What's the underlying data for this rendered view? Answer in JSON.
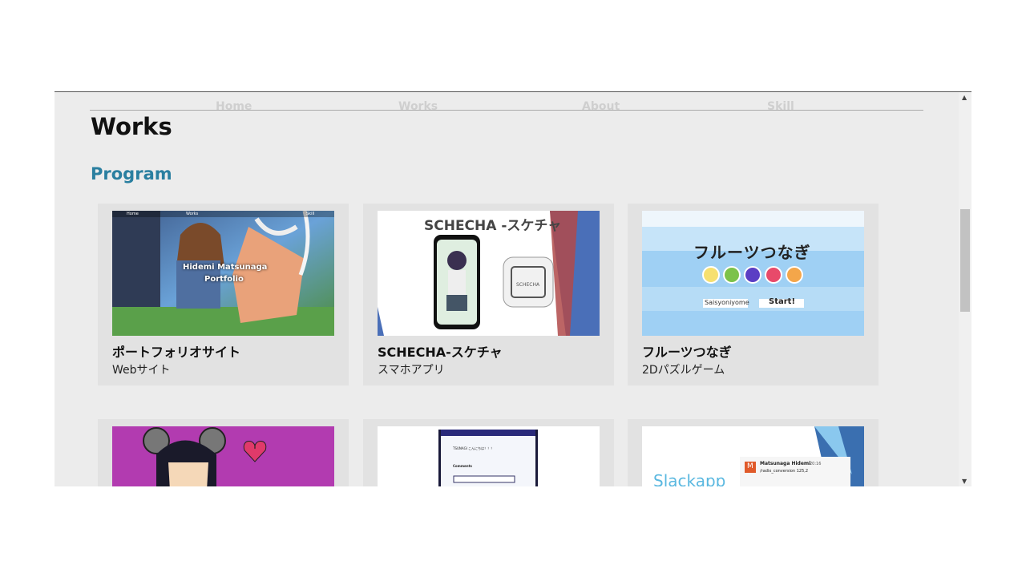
{
  "nav": {
    "items": [
      "Home",
      "Works",
      "About",
      "Skill"
    ]
  },
  "page_title": "Works",
  "section_title": "Program",
  "cards": [
    {
      "title": "ポートフォリオサイト",
      "subtitle": "Webサイト",
      "thumb": {
        "overlay_line1": "Hidemi Matsunaga",
        "overlay_line2": "Portfolio",
        "mini_nav": [
          "Home",
          "Works",
          "",
          "Skill"
        ]
      }
    },
    {
      "title": "SCHECHA-スケチャ",
      "subtitle": "スマホアプリ",
      "thumb": {
        "heading": "SCHECHA -スケチャ",
        "app_label": "SCHECHA"
      }
    },
    {
      "title": "フルーツつなぎ",
      "subtitle": "2Dパズルゲーム",
      "thumb": {
        "logo": "フルーツつなぎ",
        "input_value": "Saisyoniyome",
        "button": "Start!"
      }
    },
    {
      "title": "",
      "subtitle": "",
      "thumb": {}
    },
    {
      "title": "",
      "subtitle": "",
      "thumb": {
        "mini_text": "TSUNAGI こんにちは！！！",
        "section": "Comments"
      }
    },
    {
      "title": "",
      "subtitle": "",
      "thumb": {
        "label": "Slackapp",
        "user": "Matsunaga Hidemi",
        "time": "20:16",
        "message": "/radix_conversion 125,2",
        "avatar_letter": "M"
      }
    }
  ],
  "colors": {
    "accent": "#2a7fa0",
    "panel": "#ececec",
    "card": "#e2e2e2"
  }
}
